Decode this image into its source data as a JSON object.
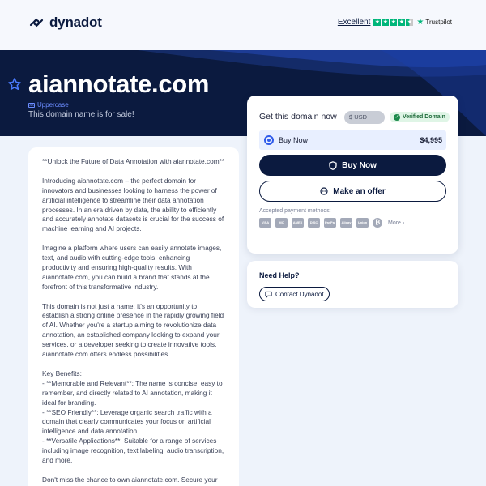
{
  "header": {
    "logo_text": "dynadot",
    "trustpilot_rating_label": "Excellent",
    "trustpilot_brand": "Trustpilot",
    "trustpilot_stars": 4.5
  },
  "hero": {
    "domain": "aiannotate.com",
    "case_label": "Uppercase",
    "sale_text": "This domain name is for sale!"
  },
  "description": {
    "paragraphs": [
      "**Unlock the Future of Data Annotation with aiannotate.com**",
      "Introducing aiannotate.com – the perfect domain for innovators and businesses looking to harness the power of artificial intelligence to streamline their data annotation processes. In an era driven by data, the ability to efficiently and accurately annotate datasets is crucial for the success of machine learning and AI projects.",
      "Imagine a platform where users can easily annotate images, text, and audio with cutting-edge tools, enhancing productivity and ensuring high-quality results. With aiannotate.com, you can build a brand that stands at the forefront of this transformative industry.",
      "This domain is not just a name; it's an opportunity to establish a strong online presence in the rapidly growing field of AI. Whether you're a startup aiming to revolutionize data annotation, an established company looking to expand your services, or a developer seeking to create innovative tools, aiannotate.com offers endless possibilities.",
      "Key Benefits:\n- **Memorable and Relevant**: The name is concise, easy to remember, and directly related to AI annotation, making it ideal for branding.\n- **SEO Friendly**: Leverage organic search traffic with a domain that clearly communicates your focus on artificial intelligence and data annotation.\n- **Versatile Applications**: Suitable for a range of services including image recognition, text labeling, audio transcription, and more.",
      "Don't miss the chance to own aiannotate.com. Secure your"
    ]
  },
  "purchase": {
    "title": "Get this domain now",
    "currency": "$ USD",
    "verified_label": "Verified Domain",
    "option_label": "Buy Now",
    "price": "$4,995",
    "buy_button": "Buy Now",
    "offer_button": "Make an offer",
    "payment_label": "Accepted payment methods:",
    "payment_methods": [
      "VISA",
      "MC",
      "AMEX",
      "DISC",
      "PayPal",
      "Alipay",
      "Union",
      "BTC"
    ],
    "more_label": "More"
  },
  "help": {
    "title": "Need Help?",
    "contact_button": "Contact Dynadot"
  },
  "colors": {
    "navy": "#0b1a3f",
    "accent_blue": "#2f5bea",
    "trustpilot_green": "#00b67a",
    "verified_green": "#1a8a4a",
    "page_bg": "#eef3fb"
  }
}
